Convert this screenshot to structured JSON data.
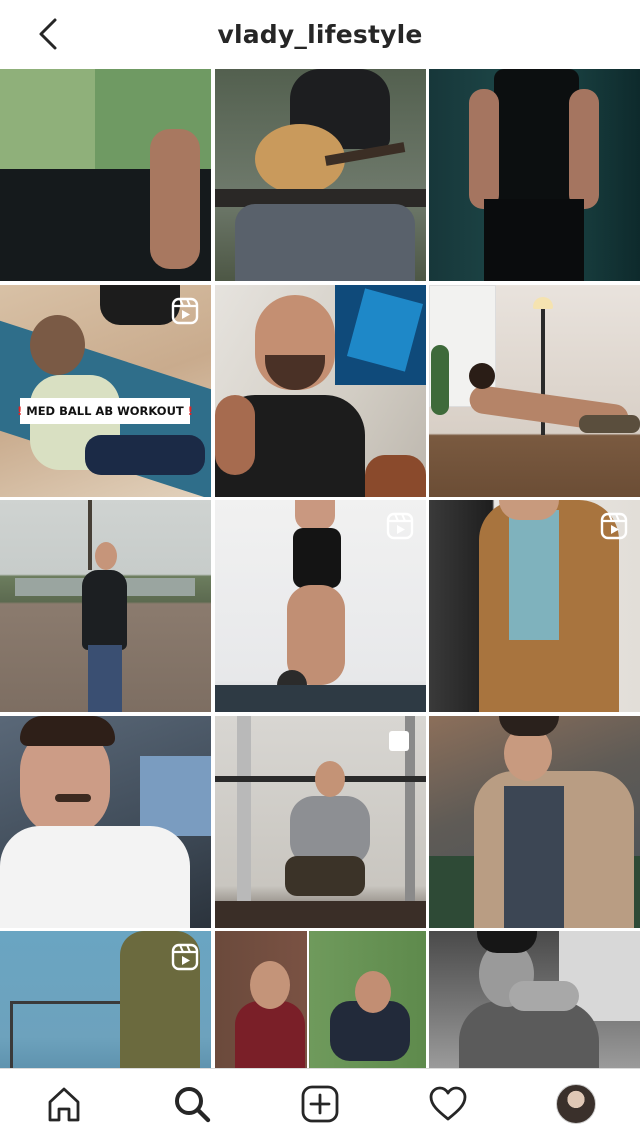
{
  "header": {
    "title": "vlady_lifestyle",
    "back_icon": "chevron-left-icon"
  },
  "grid": {
    "tiles": [
      {
        "id": "post-1",
        "badge": "none"
      },
      {
        "id": "post-2",
        "badge": "none"
      },
      {
        "id": "post-3",
        "badge": "none"
      },
      {
        "id": "post-4",
        "badge": "reel",
        "caption": "MED BALL AB WORKOUT",
        "caption_marks": "!"
      },
      {
        "id": "post-5",
        "badge": "none"
      },
      {
        "id": "post-6",
        "badge": "none"
      },
      {
        "id": "post-7",
        "badge": "none"
      },
      {
        "id": "post-8",
        "badge": "reel"
      },
      {
        "id": "post-9",
        "badge": "reel"
      },
      {
        "id": "post-10",
        "badge": "none"
      },
      {
        "id": "post-11",
        "badge": "multiple"
      },
      {
        "id": "post-12",
        "badge": "none"
      },
      {
        "id": "post-13",
        "badge": "reel"
      },
      {
        "id": "post-14",
        "badge": "none"
      },
      {
        "id": "post-15",
        "badge": "none"
      }
    ]
  },
  "tabbar": {
    "items": [
      {
        "name": "home",
        "icon": "home-icon"
      },
      {
        "name": "search",
        "icon": "search-icon",
        "active": true
      },
      {
        "name": "create",
        "icon": "plus-square-icon"
      },
      {
        "name": "activity",
        "icon": "heart-icon"
      },
      {
        "name": "profile",
        "icon": "avatar"
      }
    ]
  },
  "colors": {
    "text": "#262626",
    "border": "#dbdbdb",
    "accent_red": "#e02424"
  }
}
